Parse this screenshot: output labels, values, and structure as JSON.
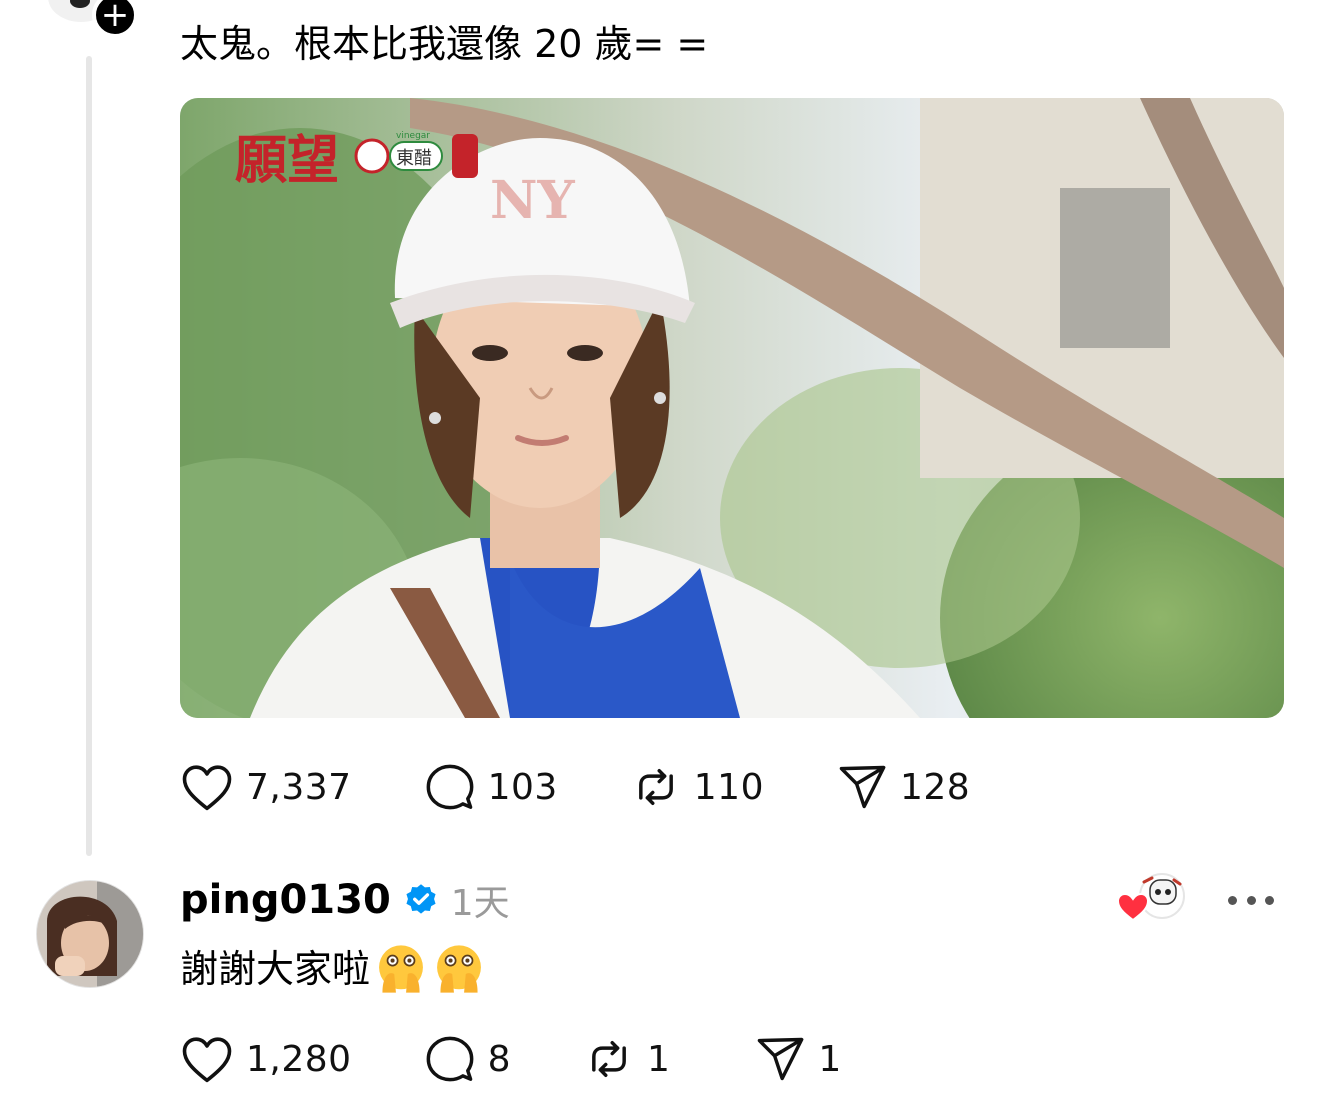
{
  "post": {
    "text": "太鬼。根本比我還像 20 歲= =",
    "image_overlay_brand": "願望",
    "image_overlay_sponsor": "東醋",
    "image_overlay_small": "vinegar",
    "stats": {
      "likes": "7,337",
      "comments": "103",
      "reposts": "110",
      "shares": "128"
    }
  },
  "reply": {
    "username": "ping0130",
    "time": "1天",
    "text": "謝謝大家啦",
    "stats": {
      "likes": "1,280",
      "comments": "8",
      "reposts": "1",
      "shares": "1"
    }
  },
  "icons": {
    "like": "heart-outline-icon",
    "comment": "speech-bubble-icon",
    "repost": "repost-arrows-icon",
    "share": "send-paper-plane-icon",
    "verified": "verified-badge-icon",
    "more": "more-dots-icon"
  },
  "colors": {
    "verified": "#0095F6",
    "heart": "#FF3040",
    "muted": "#9A9A9A"
  }
}
